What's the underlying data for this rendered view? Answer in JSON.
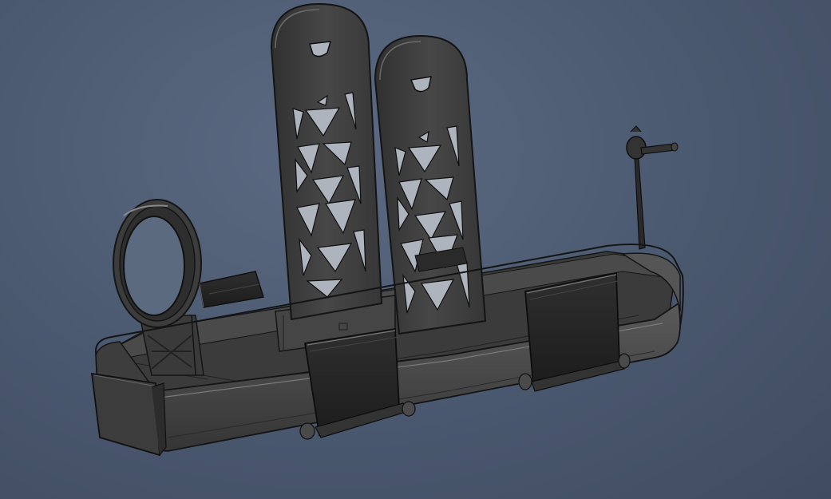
{
  "viewport": {
    "background_color": "#4e5b72",
    "model": {
      "part_fill": "#3e3e3e",
      "part_edge": "#161616",
      "part_highlight": "#6f6f6f",
      "clip_fill": "#242424",
      "opening_fill": "#aeb4bd"
    }
  }
}
